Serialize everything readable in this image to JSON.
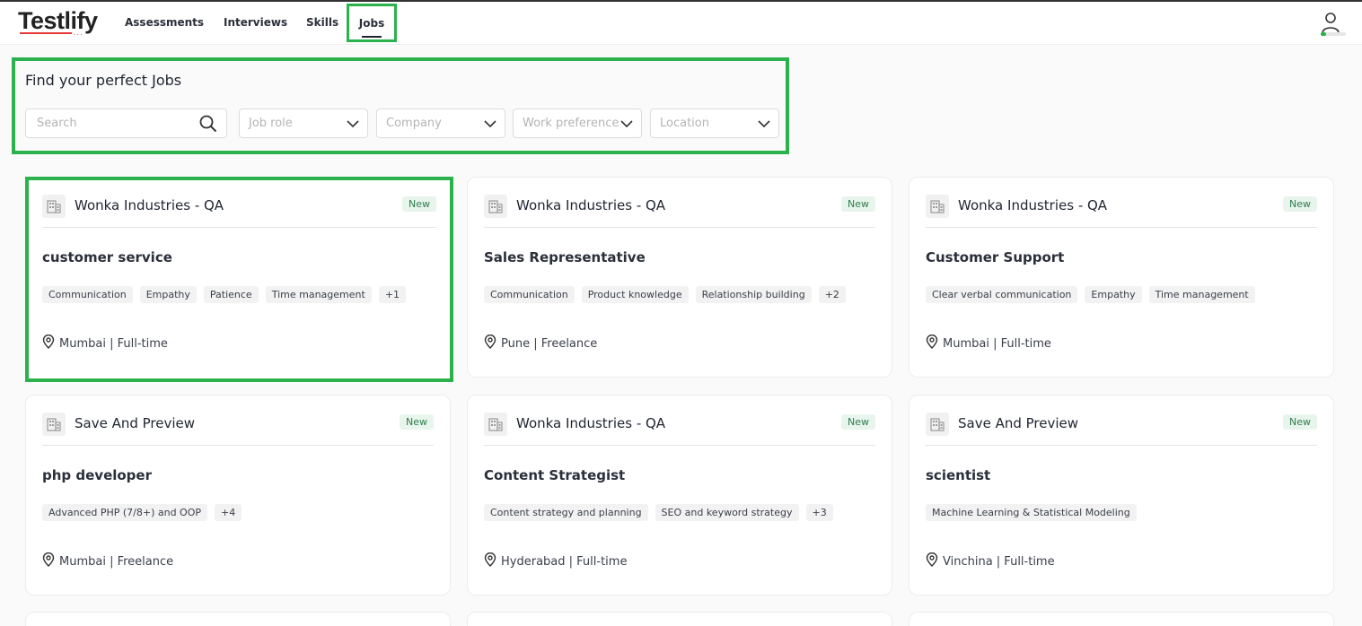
{
  "header": {
    "logo_text": "Testlify",
    "logo_dots": "...",
    "nav": [
      {
        "label": "Assessments"
      },
      {
        "label": "Interviews"
      },
      {
        "label": "Skills"
      },
      {
        "label": "Jobs",
        "active": true
      }
    ],
    "user_icon": "user-icon"
  },
  "filters": {
    "title": "Find your perfect Jobs",
    "search_placeholder": "Search",
    "dropdowns": [
      {
        "label": "Job role"
      },
      {
        "label": "Company"
      },
      {
        "label": "Work preference"
      },
      {
        "label": "Location"
      }
    ]
  },
  "jobs": [
    {
      "company": "Wonka Industries - QA",
      "badge": "New",
      "title": "customer service",
      "tags": [
        "Communication",
        "Empathy",
        "Patience",
        "Time management",
        "+1"
      ],
      "location": "Mumbai | Full-time"
    },
    {
      "company": "Wonka Industries - QA",
      "badge": "New",
      "title": "Sales Representative",
      "tags": [
        "Communication",
        "Product knowledge",
        "Relationship building",
        "+2"
      ],
      "location": "Pune | Freelance"
    },
    {
      "company": "Wonka Industries - QA",
      "badge": "New",
      "title": "Customer Support",
      "tags": [
        "Clear verbal communication",
        "Empathy",
        "Time management"
      ],
      "location": "Mumbai | Full-time"
    },
    {
      "company": "Save And Preview",
      "badge": "New",
      "title": "php developer",
      "tags": [
        "Advanced PHP (7/8+) and OOP",
        "+4"
      ],
      "location": "Mumbai | Freelance"
    },
    {
      "company": "Wonka Industries - QA",
      "badge": "New",
      "title": "Content Strategist",
      "tags": [
        "Content strategy and planning",
        "SEO and keyword strategy",
        "+3"
      ],
      "location": "Hyderabad | Full-time"
    },
    {
      "company": "Save And Preview",
      "badge": "New",
      "title": "scientist",
      "tags": [
        "Machine Learning & Statistical Modeling"
      ],
      "location": "Vinchina | Full-time"
    }
  ],
  "colors": {
    "highlight": "#2bb24c",
    "logo_accent": "#e53935",
    "badge_bg": "#e8f5ec",
    "badge_text": "#2e7d4f"
  }
}
